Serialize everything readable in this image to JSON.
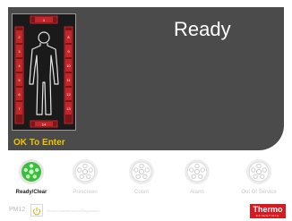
{
  "status": {
    "text": "Ready",
    "enter_message": "OK To Enter"
  },
  "portal_zones": [
    "1",
    "2",
    "3",
    "4",
    "5",
    "6",
    "7",
    "8",
    "9",
    "10",
    "11",
    "12",
    "13",
    "14"
  ],
  "toolbar": {
    "buttons": [
      {
        "label": "Ready/Clear",
        "active": true
      },
      {
        "label": "Prescreen",
        "active": false
      },
      {
        "label": "Count",
        "active": false
      },
      {
        "label": "Alarm",
        "active": false
      },
      {
        "label": "Out Of Service",
        "active": false
      }
    ]
  },
  "footer": {
    "pm_label": "PM12",
    "text": "Service/Maintenance/Diagnostics",
    "logo_main": "Thermo",
    "logo_sub": "SCIENTIFIC"
  },
  "colors": {
    "panel": "#4b4b4b",
    "enter_text": "#f0c400",
    "zone": "#c0262b",
    "active_button": "#3dbd3d",
    "logo": "#d71920"
  }
}
